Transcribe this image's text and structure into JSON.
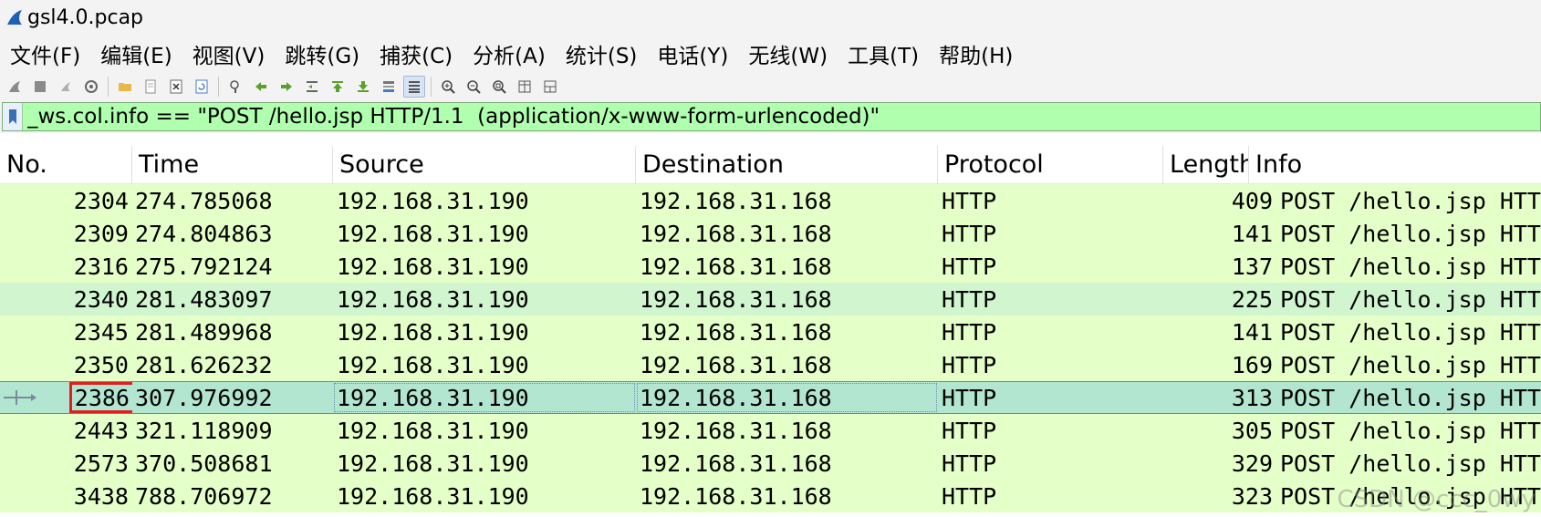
{
  "window": {
    "title": "gsl4.0.pcap"
  },
  "menu": [
    {
      "label": "文件(F)",
      "name": "menu-file"
    },
    {
      "label": "编辑(E)",
      "name": "menu-edit"
    },
    {
      "label": "视图(V)",
      "name": "menu-view"
    },
    {
      "label": "跳转(G)",
      "name": "menu-go"
    },
    {
      "label": "捕获(C)",
      "name": "menu-capture"
    },
    {
      "label": "分析(A)",
      "name": "menu-analyze"
    },
    {
      "label": "统计(S)",
      "name": "menu-statistics"
    },
    {
      "label": "电话(Y)",
      "name": "menu-telephony"
    },
    {
      "label": "无线(W)",
      "name": "menu-wireless"
    },
    {
      "label": "工具(T)",
      "name": "menu-tools"
    },
    {
      "label": "帮助(H)",
      "name": "menu-help"
    }
  ],
  "toolbar": {
    "icons": [
      "shark-fin-start-icon",
      "stop-capture-icon",
      "restart-capture-icon",
      "capture-options-icon",
      "open-file-icon",
      "save-file-icon",
      "close-file-icon",
      "reload-file-icon",
      "find-packet-icon",
      "go-back-icon",
      "go-forward-icon",
      "go-to-packet-icon",
      "go-first-icon",
      "go-last-icon",
      "auto-scroll-icon",
      "colorize-icon",
      "zoom-in-icon",
      "zoom-out-icon",
      "zoom-normal-icon",
      "resize-columns-icon",
      "layout-icon"
    ]
  },
  "filter": {
    "value": "_ws.col.info == \"POST /hello.jsp HTTP/1.1  (application/x-www-form-urlencoded)\""
  },
  "columns": {
    "no": "No.",
    "time": "Time",
    "source": "Source",
    "destination": "Destination",
    "protocol": "Protocol",
    "length": "Length",
    "info": "Info"
  },
  "packets": [
    {
      "no": "2304",
      "time": "274.785068",
      "source": "192.168.31.190",
      "destination": "192.168.31.168",
      "protocol": "HTTP",
      "length": "409",
      "info": "POST /hello.jsp HTTP"
    },
    {
      "no": "2309",
      "time": "274.804863",
      "source": "192.168.31.190",
      "destination": "192.168.31.168",
      "protocol": "HTTP",
      "length": "141",
      "info": "POST /hello.jsp HTTP"
    },
    {
      "no": "2316",
      "time": "275.792124",
      "source": "192.168.31.190",
      "destination": "192.168.31.168",
      "protocol": "HTTP",
      "length": "137",
      "info": "POST /hello.jsp HTTP"
    },
    {
      "no": "2340",
      "time": "281.483097",
      "source": "192.168.31.190",
      "destination": "192.168.31.168",
      "protocol": "HTTP",
      "length": "225",
      "info": "POST /hello.jsp HTTP"
    },
    {
      "no": "2345",
      "time": "281.489968",
      "source": "192.168.31.190",
      "destination": "192.168.31.168",
      "protocol": "HTTP",
      "length": "141",
      "info": "POST /hello.jsp HTTP"
    },
    {
      "no": "2350",
      "time": "281.626232",
      "source": "192.168.31.190",
      "destination": "192.168.31.168",
      "protocol": "HTTP",
      "length": "169",
      "info": "POST /hello.jsp HTTP"
    },
    {
      "no": "2386",
      "time": "307.976992",
      "source": "192.168.31.190",
      "destination": "192.168.31.168",
      "protocol": "HTTP",
      "length": "313",
      "info": "POST /hello.jsp HTTP"
    },
    {
      "no": "2443",
      "time": "321.118909",
      "source": "192.168.31.190",
      "destination": "192.168.31.168",
      "protocol": "HTTP",
      "length": "305",
      "info": "POST /hello.jsp HTTP"
    },
    {
      "no": "2573",
      "time": "370.508681",
      "source": "192.168.31.190",
      "destination": "192.168.31.168",
      "protocol": "HTTP",
      "length": "329",
      "info": "POST /hello.jsp HTTP"
    },
    {
      "no": "3438",
      "time": "788.706972",
      "source": "192.168.31.190",
      "destination": "192.168.31.168",
      "protocol": "HTTP",
      "length": "323",
      "info": "POST /hello.jsp HTTP"
    }
  ],
  "watermark": "CSDN @ccc_0wy",
  "colors": {
    "filter_valid": "#afffaf",
    "row_http": "#e4ffc7",
    "row_alt": "#d0f5cf",
    "row_selected": "#b2e6d0",
    "highlight_box": "#e02020"
  }
}
